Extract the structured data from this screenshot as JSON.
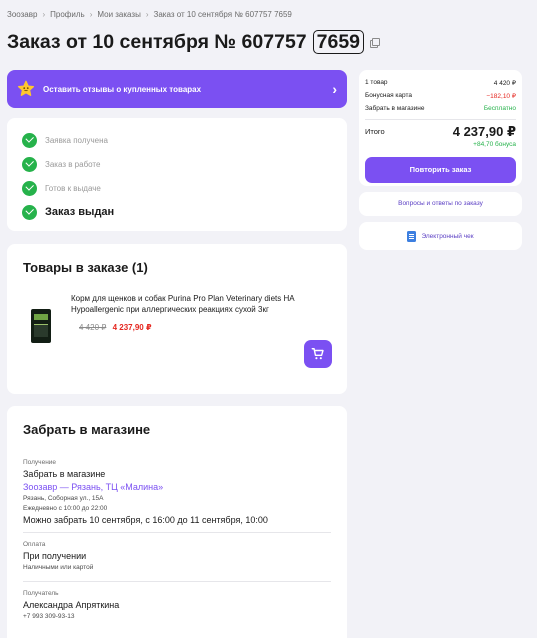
{
  "breadcrumbs": [
    {
      "label": "Зоозавр"
    },
    {
      "label": "Профиль"
    },
    {
      "label": "Мои заказы"
    },
    {
      "label": "Заказ от 10 сентября № 607757 7659"
    }
  ],
  "title": {
    "main": "Заказ от 10 сентября № 607757",
    "number_suffix": "7659"
  },
  "review_banner": {
    "text": "Оставить отзывы о купленных товарах"
  },
  "status_steps": [
    {
      "label": "Заявка получена"
    },
    {
      "label": "Заказ в работе"
    },
    {
      "label": "Готов к выдаче"
    },
    {
      "label": "Заказ выдан"
    }
  ],
  "goods": {
    "heading": "Товары в заказе (1)",
    "items": [
      {
        "name": "Корм для щенков и собак Purina Pro Plan Veterinary diets HA Hypoallergenic при аллергических реакциях сухой 3кг",
        "old_price": "4 420 ₽",
        "price": "4 237,90 ₽"
      }
    ]
  },
  "pickup": {
    "heading": "Забрать в магазине",
    "receipt_section": {
      "caption": "Получение",
      "method": "Забрать в магазине",
      "store": "Зоозавр — Рязань, ТЦ «Малина»",
      "address": "Рязань, Соборная ул., 15А",
      "hours": "Ежедневно с 10:00 до 22:00",
      "pickup_window": "Можно забрать 10 сентября, с 16:00 до 11 сентября, 10:00"
    },
    "payment_section": {
      "caption": "Оплата",
      "method": "При получении",
      "detail": "Наличными или картой"
    },
    "recipient_section": {
      "caption": "Получатель",
      "name": "Александра Апряткина",
      "phone": "+7 993 309-93-13"
    }
  },
  "summary": {
    "rows": [
      {
        "label": "1 товар",
        "value": "4 420 ₽",
        "tone": "normal"
      },
      {
        "label": "Бонусная карта",
        "value": "−182,10 ₽",
        "tone": "red"
      },
      {
        "label": "Забрать в магазине",
        "value": "Бесплатно",
        "tone": "green"
      }
    ],
    "total_label": "Итого",
    "total_value": "4 237,90 ₽",
    "bonus": "+84,70 бонуса",
    "repeat_label": "Повторить заказ"
  },
  "links": {
    "qa": "Вопросы и ответы по заказу",
    "receipt": "Электронный чек"
  },
  "colors": {
    "accent": "#7b50f2",
    "success": "#26b24b",
    "price_red": "#e5261f",
    "background": "#f2f2f7"
  }
}
